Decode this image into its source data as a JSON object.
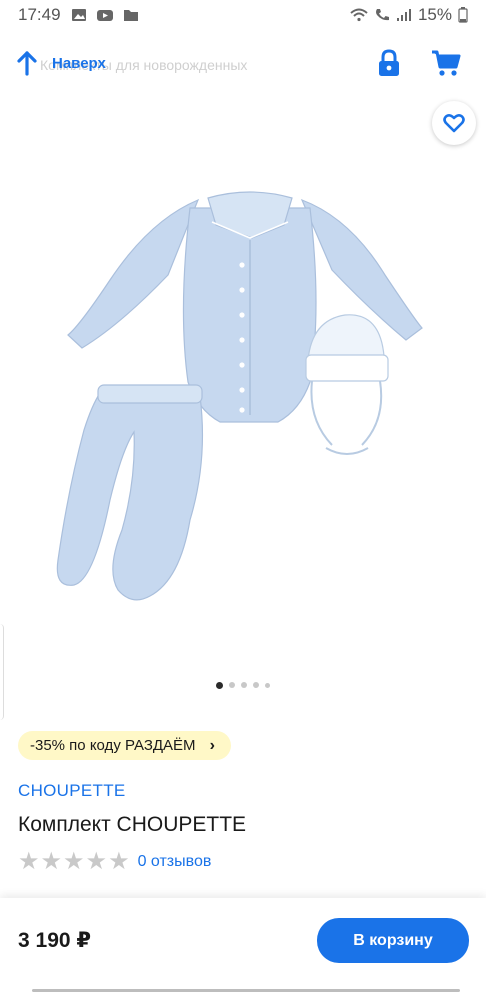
{
  "status_bar": {
    "time": "17:49",
    "battery": "15%",
    "icons": [
      "image-icon",
      "youtube-icon",
      "folder-icon",
      "wifi-icon",
      "call-icon",
      "signal-icon",
      "battery-icon"
    ]
  },
  "nav": {
    "back_label": "Наверх",
    "ghost_breadcrumb": "Комплекты для новорожденных",
    "icons": [
      "arrow-up-icon",
      "lock-icon",
      "cart-icon"
    ]
  },
  "product": {
    "image_icon": "baby-outfit-image",
    "carousel": {
      "total": 5,
      "active": 0
    },
    "promo": "-35% по коду РАЗДАЁМ",
    "brand": "CHOUPETTE",
    "title": "Комплект CHOUPETTE",
    "rating": 0,
    "reviews": "0 отзывов",
    "price": "3 190 ₽",
    "add_to_cart": "В корзину"
  },
  "colors": {
    "accent": "#1a73e8",
    "promo_bg": "#fff8c7",
    "star_empty": "#c9c9c9",
    "garment": "#c6d8ef"
  }
}
